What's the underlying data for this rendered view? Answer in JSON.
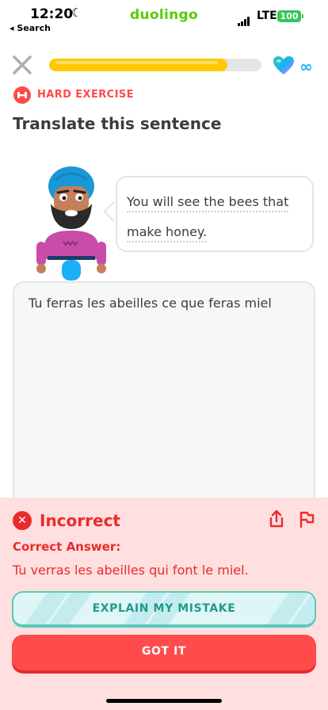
{
  "status_bar": {
    "time": "12:20",
    "back_label": "◂ Search",
    "carrier": "duolingo",
    "network": "LTE",
    "battery": "100"
  },
  "lesson": {
    "progress_fraction": 0.84,
    "hearts": "∞",
    "exercise_badge": "HARD EXERCISE",
    "title": "Translate this sentence",
    "prompt_line1": "You will see the bees that",
    "prompt_line2": "make honey.",
    "user_answer": "Tu ferras les abeilles ce que feras miel"
  },
  "feedback": {
    "heading": "Incorrect",
    "correct_label": "Correct Answer:",
    "correct_answer": "Tu verras les abeilles qui font le miel.",
    "explain_button": "EXPLAIN MY MISTAKE",
    "continue_button": "GOT IT"
  },
  "colors": {
    "brand": "#58cc02",
    "error": "#ea2b2b",
    "progress": "#ffc800",
    "explain": "#1d9c8e"
  }
}
